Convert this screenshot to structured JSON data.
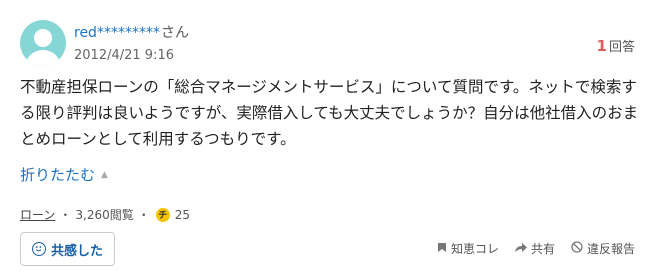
{
  "user": {
    "name": "red*********",
    "suffix": "さん",
    "date": "2012/4/21 9:16"
  },
  "answers": {
    "count": "1",
    "label": "回答"
  },
  "question": {
    "text": "不動産担保ローンの「総合マネージメントサービス」について質問です。ネットで検索する限り評判は良いようですが、実際借入しても大丈夫でしょうか？自分は他社借入のおまとめローンとして利用するつもりです。"
  },
  "fold": {
    "label": "折りたたむ"
  },
  "meta": {
    "category": "ローン",
    "views": "3,260閲覧",
    "separator": "・",
    "chie_icon": "チ",
    "chie_coins": "25"
  },
  "buttons": {
    "empathy": "共感した"
  },
  "actions": {
    "save": "知恵コレ",
    "share": "共有",
    "report": "違反報告"
  },
  "colors": {
    "link": "#1a73c7",
    "accent_red": "#e05a5a",
    "avatar": "#86d6d6",
    "coin": "#f5c400"
  }
}
